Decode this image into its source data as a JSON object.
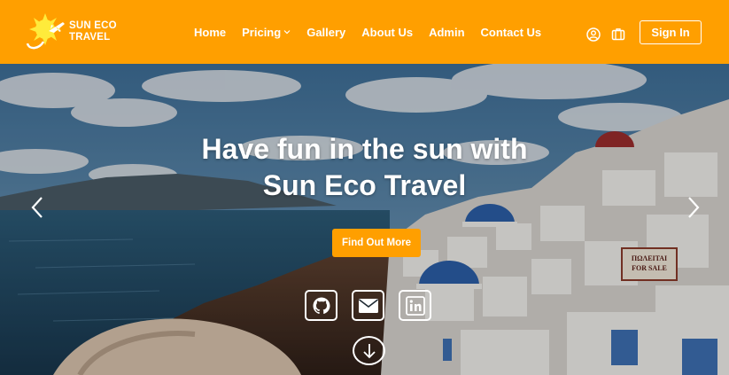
{
  "brand": {
    "line1": "SUN ECO",
    "line2": "TRAVEL"
  },
  "nav": {
    "items": [
      {
        "label": "Home"
      },
      {
        "label": "Pricing"
      },
      {
        "label": "Gallery"
      },
      {
        "label": "About Us"
      },
      {
        "label": "Admin"
      },
      {
        "label": "Contact Us"
      }
    ]
  },
  "header_icons": [
    "user-circle-icon",
    "suitcase-icon"
  ],
  "sign_in_label": "Sign In",
  "hero": {
    "headline_line1": "Have fun in the sun with",
    "headline_line2": "Sun Eco Travel",
    "cta_label": "Find Out More",
    "social_icons": [
      "github-icon",
      "envelope-icon",
      "linkedin-icon"
    ],
    "scroll_icon": "arrow-down-icon",
    "prev_icon": "chevron-left-icon",
    "next_icon": "chevron-right-icon",
    "sign_text_line1": "ΠΩΛΕΙΤΑΙ",
    "sign_text_line2": "FOR SALE"
  },
  "colors": {
    "brand_orange": "#ff9f00",
    "white": "#ffffff"
  }
}
